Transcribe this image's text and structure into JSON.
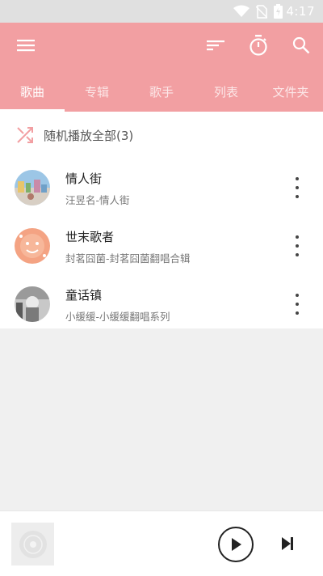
{
  "status_bar": {
    "time": "4:17",
    "icons": [
      "wifi-icon",
      "no-sim-icon",
      "battery-charging-icon"
    ]
  },
  "app_bar": {
    "color": "#f29fa2",
    "icons": [
      "menu-icon",
      "sort-icon",
      "timer-icon",
      "search-icon"
    ]
  },
  "tabs": [
    {
      "label": "歌曲",
      "active": true
    },
    {
      "label": "专辑",
      "active": false
    },
    {
      "label": "歌手",
      "active": false
    },
    {
      "label": "列表",
      "active": false
    },
    {
      "label": "文件夹",
      "active": false
    }
  ],
  "shuffle": {
    "label": "随机播放全部(3)",
    "icon": "shuffle-icon"
  },
  "songs": [
    {
      "title": "情人街",
      "subtitle": "汪昱名-情人街"
    },
    {
      "title": "世末歌者",
      "subtitle": "封茗囧菌-封茗囧菌翻唱合辑"
    },
    {
      "title": "童话镇",
      "subtitle": "小缓缓-小缓缓翻唱系列"
    }
  ],
  "player": {
    "icons": [
      "album-art-placeholder-icon",
      "play-icon",
      "skip-next-icon"
    ]
  }
}
